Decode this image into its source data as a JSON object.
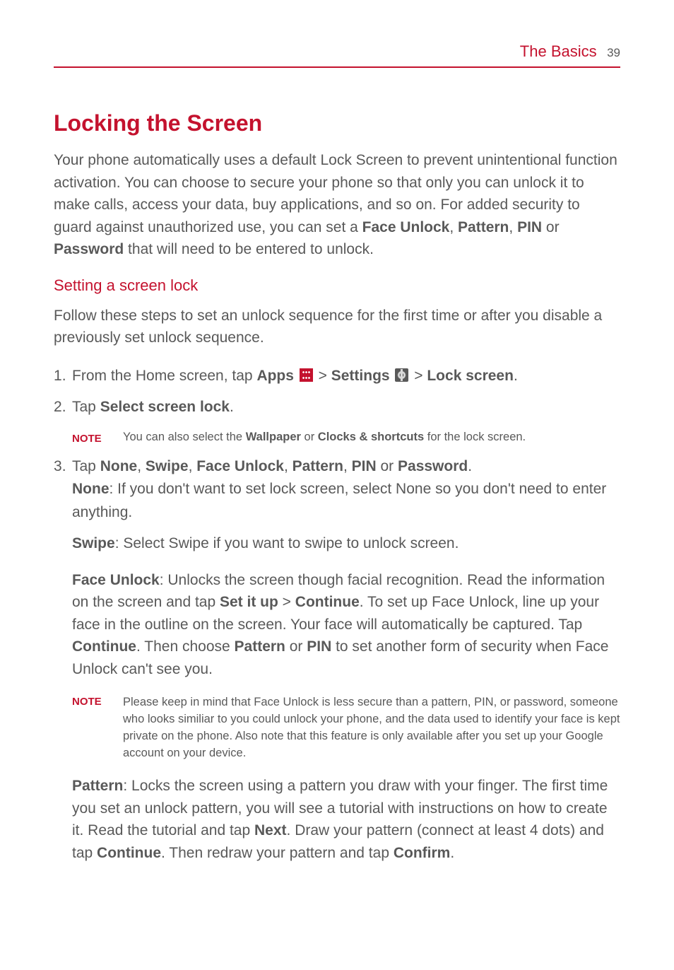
{
  "header": {
    "title": "The Basics",
    "page_number": "39"
  },
  "section": {
    "title": "Locking the Screen",
    "intro_1": "Your phone automatically uses a default Lock Screen to prevent unintentional function activation. You can choose to secure your phone so that only you can unlock it to make calls, access your data, buy applications, and so on. For added security to guard against unauthorized use, you can set a ",
    "intro_b1": "Face Unlock",
    "intro_2": ", ",
    "intro_b2": "Pattern",
    "intro_3": ", ",
    "intro_b3": "PIN",
    "intro_4": " or ",
    "intro_b4": "Password",
    "intro_5": " that will need to be entered to unlock."
  },
  "subsection": {
    "title": "Setting a screen lock",
    "intro": "Follow these steps to set an unlock sequence for the first time or after you disable a previously set unlock sequence."
  },
  "step1": {
    "t1": "From the Home screen, tap ",
    "b1": "Apps",
    "gt1": " > ",
    "b2": "Settings",
    "gt2": " > ",
    "b3": "Lock screen",
    "period": "."
  },
  "step2": {
    "t1": "Tap ",
    "b1": "Select screen lock",
    "period": "."
  },
  "note1": {
    "label": "NOTE",
    "t1": "You can also select the ",
    "b1": "Wallpaper",
    "t2": " or ",
    "b2": "Clocks & shortcuts",
    "t3": " for the lock screen."
  },
  "step3": {
    "t1": "Tap ",
    "b1": "None",
    "c1": ", ",
    "b2": "Swipe",
    "c2": ", ",
    "b3": "Face Unlock",
    "c3": ", ",
    "b4": "Pattern",
    "c4": ", ",
    "b5": "PIN",
    "c5": " or ",
    "b6": "Password",
    "period": ".",
    "none_b": "None",
    "none_t": ": If you don't want to set lock screen, select None so you don't need to enter anything."
  },
  "swipe": {
    "b": "Swipe",
    "t": ": Select Swipe if you want to swipe to unlock screen."
  },
  "face_unlock": {
    "b1": "Face Unlock",
    "t1": ": Unlocks the screen though facial recognition. Read the information on the screen and tap ",
    "b2": "Set it up",
    "t2": " > ",
    "b3": "Continue",
    "t3": ". To set up Face Unlock, line up your face in the outline on the screen. Your face will automatically be captured. Tap ",
    "b4": "Continue",
    "t4": ". Then choose ",
    "b5": "Pattern",
    "t5": " or ",
    "b6": "PIN",
    "t6": " to set another form of security when Face Unlock can't see you."
  },
  "note2": {
    "label": "NOTE",
    "text": "Please keep in mind that Face Unlock is less secure than a pattern, PIN, or password, someone who looks similiar to you could unlock your phone, and the data used to identify your face is kept private on the phone. Also note that this feature is only available after you set up your Google account on your device."
  },
  "pattern": {
    "b1": "Pattern",
    "t1": ": Locks the screen using a pattern you draw with your finger. The first time you set an unlock pattern, you will see a tutorial with instructions on how to create it. Read the tutorial and tap ",
    "b2": "Next",
    "t2": ". Draw your pattern (connect at least 4 dots) and tap ",
    "b3": "Continue",
    "t3": ". Then redraw your pattern and tap ",
    "b4": "Confirm",
    "t4": "."
  }
}
